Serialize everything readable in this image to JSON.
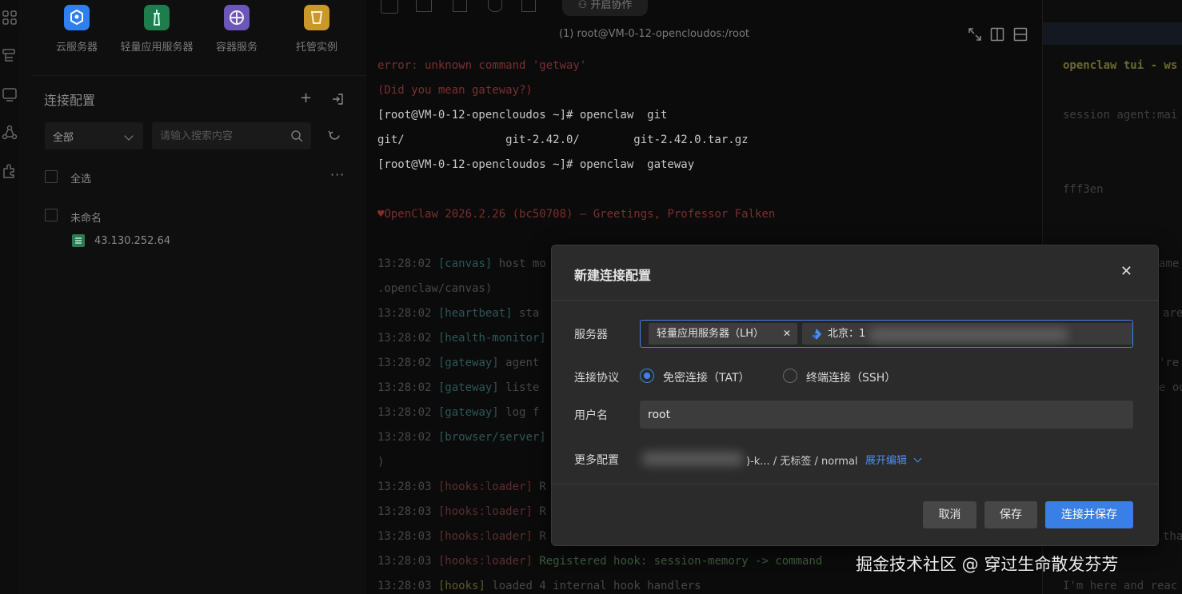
{
  "left_panel": {
    "services": [
      {
        "label": "云服务器",
        "icon": "cloud-server-icon",
        "color": "#2f7ff0"
      },
      {
        "label": "轻量应用服务器",
        "icon": "lighthouse-icon",
        "color": "#27b06a"
      },
      {
        "label": "容器服务",
        "icon": "container-icon",
        "color": "#8b6fe0"
      },
      {
        "label": "托管实例",
        "icon": "managed-instance-icon",
        "color": "#e6b12e"
      }
    ],
    "title": "连接配置",
    "filter_select": "全部",
    "search_placeholder": "请输入搜索内容",
    "select_all": "全选",
    "group_name": "未命名",
    "host_ip": "43.130.252.64"
  },
  "terminal": {
    "title": "(1) root@VM-0-12-opencloudos:/root",
    "toolbar_label": "开启协作",
    "lines": [
      {
        "text": "error: unknown command 'getway'"
      },
      {
        "text": "(Did you mean gateway?)"
      },
      {
        "text": "[root@VM-0-12-opencloudos ~]# openclaw  git"
      },
      {
        "text": "git/               git-2.42.0/        git-2.42.0.tar.gz"
      },
      {
        "text": "[root@VM-0-12-opencloudos ~]# openclaw  gateway"
      },
      {
        "text": "OpenClaw 2026.2.26 (bc50708) — Greetings, Professor Falken"
      },
      {
        "time": "13:28:02",
        "tag": "[canvas]",
        "msg": " host mo"
      },
      {
        "text": ".openclaw/canvas)"
      },
      {
        "time": "13:28:02",
        "tag": "[heartbeat]",
        "msg": " sta"
      },
      {
        "time": "13:28:02",
        "tag": "[health-monitor]",
        "msg": ""
      },
      {
        "time": "13:28:02",
        "tag": "[gateway]",
        "msg": " agent"
      },
      {
        "time": "13:28:02",
        "tag": "[gateway]",
        "msg": " liste"
      },
      {
        "time": "13:28:02",
        "tag": "[gateway]",
        "msg": " log f"
      },
      {
        "time": "13:28:02",
        "tag": "[browser/server]",
        "msg": ""
      },
      {
        "text": ")"
      },
      {
        "time": "13:28:03",
        "tag": "[hooks:loader]",
        "msg": " R"
      },
      {
        "time": "13:28:03",
        "tag": "[hooks:loader]",
        "msg": " R"
      },
      {
        "time": "13:28:03",
        "tag": "[hooks:loader]",
        "msg": " R"
      },
      {
        "time": "13:28:03",
        "tag": "[hooks:loader]",
        "msg": " Registered hook: session-memory -> command"
      },
      {
        "time": "13:28:03",
        "tag": "[hooks]",
        "msg": " loaded 4 internal hook handlers"
      }
    ]
  },
  "right_panel": {
    "lines": [
      "openclaw tui - ws",
      "session agent:mai",
      "fff3en",
      "ame",
      "are",
      "'re",
      "e ou",
      "tha",
      "I'm here and reac"
    ]
  },
  "dialog": {
    "title": "新建连接配置",
    "server_label": "服务器",
    "server_tag": "轻量应用服务器（LH）",
    "server_region": "北京：1",
    "protocol_label": "连接协议",
    "protocol_options": [
      "免密连接（TAT）",
      "终端连接（SSH）"
    ],
    "protocol_selected": 0,
    "username_label": "用户名",
    "username_value": "root",
    "more_label": "更多配置",
    "more_text": ")-k... / 无标签 / normal",
    "expand_label": "展开编辑",
    "cancel": "取消",
    "save": "保存",
    "connect_save": "连接并保存"
  },
  "watermark": "掘金技术社区 @ 穿过生命散发芬芳",
  "colors": {
    "accent": "#3a7fe6",
    "dialog_bg": "#2b2b2b"
  }
}
